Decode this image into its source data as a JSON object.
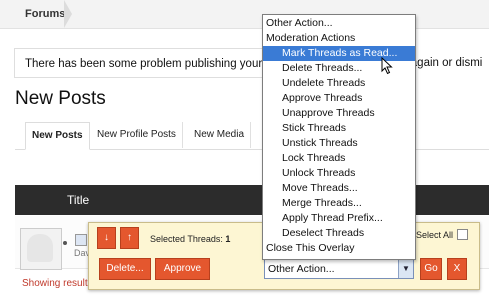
{
  "breadcrumb": {
    "item": "Forums"
  },
  "notice": {
    "text": "There has been some problem publishing your",
    "text_right": "ry again or dismi"
  },
  "page_title": "New Posts",
  "tabs": [
    {
      "label": "New Posts",
      "active": true
    },
    {
      "label": "New Profile Posts",
      "active": false
    },
    {
      "label": "New Media",
      "active": false
    }
  ],
  "table": {
    "column_title": "Title"
  },
  "row": {
    "partial_text": "Dav"
  },
  "showing": "Showing results 1 to 1 of 1",
  "overlay": {
    "delete_label": "Delete...",
    "approve_label": "Approve",
    "selected_label": "Selected Threads:",
    "selected_count": "1",
    "select_all_label": "Select All",
    "action_select_value": "Other Action...",
    "go_label": "Go",
    "close_label": "X",
    "arrow_down": "↓",
    "arrow_up": "↑"
  },
  "dropdown": {
    "options": [
      {
        "label": "Other Action...",
        "kind": "top"
      },
      {
        "label": "Moderation Actions",
        "kind": "group"
      },
      {
        "label": "Mark Threads as Read...",
        "kind": "child",
        "highlighted": true
      },
      {
        "label": "Delete Threads...",
        "kind": "child"
      },
      {
        "label": "Undelete Threads",
        "kind": "child"
      },
      {
        "label": "Approve Threads",
        "kind": "child"
      },
      {
        "label": "Unapprove Threads",
        "kind": "child"
      },
      {
        "label": "Stick Threads",
        "kind": "child"
      },
      {
        "label": "Unstick Threads",
        "kind": "child"
      },
      {
        "label": "Lock Threads",
        "kind": "child"
      },
      {
        "label": "Unlock Threads",
        "kind": "child"
      },
      {
        "label": "Move Threads...",
        "kind": "child"
      },
      {
        "label": "Merge Threads...",
        "kind": "child"
      },
      {
        "label": "Apply Thread Prefix...",
        "kind": "child"
      },
      {
        "label": "Deselect Threads",
        "kind": "child"
      },
      {
        "label": "Close This Overlay",
        "kind": "top"
      }
    ]
  },
  "colors": {
    "accent": "#e4572e",
    "highlight": "#3a7bd5",
    "overlay_bg": "#fdf6d3",
    "header_bg": "#2c2c2c"
  }
}
